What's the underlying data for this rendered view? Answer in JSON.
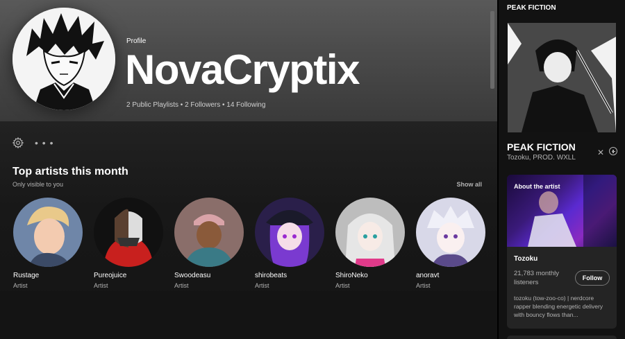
{
  "profile": {
    "label": "Profile",
    "name": "NovaCryptix",
    "stats": "2 Public Playlists • 2 Followers • 14 Following"
  },
  "actions": {
    "more_label": "• • •"
  },
  "top_artists": {
    "title": "Top artists this month",
    "subtitle": "Only visible to you",
    "show_all": "Show all",
    "items": [
      {
        "name": "Rustage",
        "role": "Artist"
      },
      {
        "name": "Pureojuice",
        "role": "Artist"
      },
      {
        "name": "Swoodeasu",
        "role": "Artist"
      },
      {
        "name": "shirobeats",
        "role": "Artist"
      },
      {
        "name": "ShiroNeko",
        "role": "Artist"
      },
      {
        "name": "anoravt",
        "role": "Artist"
      }
    ]
  },
  "now_playing": {
    "header": "PEAK FICTION",
    "title": "PEAK FICTION",
    "artists": "Tozoku, PROD. WXLL",
    "close_glyph": "✕"
  },
  "about": {
    "label": "About the artist",
    "artist": "Tozoku",
    "listeners": "21,783 monthly listeners",
    "follow": "Follow",
    "bio": "tozoku (tow-zoo-co) | nerdcore rapper blending energetic delivery with bouncy flows than..."
  },
  "colors": {
    "background": "#121212",
    "hero_gradient_top": "#595959",
    "text_secondary": "#b3b3b3"
  }
}
